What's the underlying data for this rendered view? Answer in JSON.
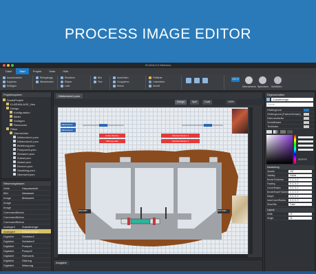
{
  "banner": {
    "title": "PROCESS IMAGE EDITOR"
  },
  "window": {
    "title": "SCADA 5.6 Webview"
  },
  "tabs": [
    {
      "label": "Datei"
    },
    {
      "label": "Start"
    },
    {
      "label": "Projekt"
    },
    {
      "label": "Seite"
    },
    {
      "label": "Hilfe"
    }
  ],
  "ribbon": {
    "g1": [
      "Ausschneiden",
      "Kopieren",
      "Einfügen"
    ],
    "g2": [
      "Rückgängig",
      "Wiederholen"
    ],
    "g3": [
      "Rechteck",
      "Ellipse",
      "Linie"
    ],
    "g4": [
      "Bild",
      "Text"
    ],
    "g5": [
      "Ausrichten",
      "Gruppieren",
      "Ebene"
    ],
    "g6": [
      "Füllfarbe",
      "Linienfarbe",
      "Schrift"
    ],
    "zoom": "100 %",
    "big_buttons": [
      "Übernehmen",
      "Speichern",
      "Schließen"
    ]
  },
  "project_panel": {
    "title": "Projektexplorer",
    "items": [
      {
        "label": "ScadaProjekt",
        "type": "folder",
        "indent": 0
      },
      {
        "label": "KLÄRANLAGE_Neu",
        "type": "folder",
        "indent": 1
      },
      {
        "label": "Design",
        "type": "folder",
        "indent": 1
      },
      {
        "label": "Konfiguration",
        "type": "folder",
        "indent": 2
      },
      {
        "label": "Bilder",
        "type": "folder",
        "indent": 2
      },
      {
        "label": "Vorlagen",
        "type": "folder",
        "indent": 2
      },
      {
        "label": "Resourcen",
        "type": "folder",
        "indent": 2
      },
      {
        "label": "Pläne",
        "type": "folder",
        "indent": 1
      },
      {
        "label": "Übersichten",
        "type": "folder",
        "indent": 2
      },
      {
        "label": "Klärbecken1.psm",
        "type": "file",
        "indent": 3
      },
      {
        "label": "Klärbecken2.psm",
        "type": "file",
        "indent": 3
      },
      {
        "label": "Belebung.psm",
        "type": "file",
        "indent": 3
      },
      {
        "label": "Pumpwerk.psm",
        "type": "file",
        "indent": 3
      },
      {
        "label": "Schlamm.psm",
        "type": "file",
        "indent": 3
      },
      {
        "label": "Zulauf.psm",
        "type": "file",
        "indent": 3
      },
      {
        "label": "Ablauf.psm",
        "type": "file",
        "indent": 3
      },
      {
        "label": "Rechen.psm",
        "type": "file",
        "indent": 3
      },
      {
        "label": "Sandfang.psm",
        "type": "file",
        "indent": 3
      },
      {
        "label": "Übersicht.psm",
        "type": "file",
        "indent": 3
      }
    ]
  },
  "props_panel": {
    "title": "Steuerungsbaum",
    "rows": [
      {
        "k": "Seite",
        "v": "Hauptansicht",
        "sel": false
      },
      {
        "k": "Bild",
        "v": "Abwasser",
        "sel": false
      },
      {
        "k": "Image",
        "v": "Messwert",
        "sel": false
      },
      {
        "k": "Image",
        "v": "",
        "sel": false
      },
      {
        "k": "Image",
        "v": "",
        "sel": false
      },
      {
        "k": "CommandButton",
        "v": "",
        "sel": false
      },
      {
        "k": "CommandButton",
        "v": "",
        "sel": false
      },
      {
        "k": "CommandButton",
        "v": "",
        "sel": false
      },
      {
        "k": "Analoglnt",
        "v": "Zulaufmenge",
        "sel": false
      },
      {
        "k": "Analoglnt",
        "v": "Ablaufmenge",
        "sel": true
      },
      {
        "k": "Digitallnt",
        "v": "Schieber1",
        "sel": false
      },
      {
        "k": "Digitallnt",
        "v": "Schieber2",
        "sel": false
      },
      {
        "k": "Digitallnt",
        "v": "Pumpe1",
        "sel": false
      },
      {
        "k": "Digitallnt",
        "v": "Pumpe2",
        "sel": false
      },
      {
        "k": "Digitallnt",
        "v": "Rührwerk",
        "sel": false
      },
      {
        "k": "Digitallnt",
        "v": "Störung",
        "sel": false
      },
      {
        "k": "Digitallnt",
        "v": "Warnung",
        "sel": false
      }
    ]
  },
  "editor": {
    "doc_tab": "Klärbecken1.psm",
    "view_buttons": [
      "Design",
      "Split",
      "Code"
    ],
    "zoom": "100%",
    "side_buttons": [
      "Klärbecken1",
      "Klärbecken2"
    ],
    "red_buttons": [
      "Fehler Becken",
      "Wartung aktiv",
      "Überlauf Becken 1",
      "Überlauf Becken 2"
    ],
    "labels": [
      "AMS-SN83",
      "AMS-SN84"
    ],
    "bottom_title": "Ausgabe"
  },
  "right_panel": {
    "title": "Eigenschaften",
    "name": "Zulaufmenge",
    "search": "Suche",
    "color_rows": [
      "Hintergrund",
      "Hintergrund (Farbe/Verlauf)",
      "Rahmenfarbe",
      "Schriftfarbe",
      "Textfarbe"
    ],
    "hex": "FFFFFF",
    "section": "Darstellung",
    "props": [
      {
        "k": "Opacity",
        "v": "100"
      },
      {
        "k": "Visibility",
        "v": "Visible"
      },
      {
        "k": "BorderThickness",
        "v": "1, 1, 1, 1"
      },
      {
        "k": "Padding",
        "v": "0, 0, 0, 0"
      },
      {
        "k": "CornerRadius",
        "v": "0, 0, 0, 0"
      },
      {
        "k": "BorderBrushThickness",
        "v": "1, 1, 1, 1"
      },
      {
        "k": "Margin",
        "v": "0, 0, 0, 0"
      },
      {
        "k": "InnerCornerRadius",
        "v": "0, 0, 0, 0"
      },
      {
        "k": "ShowTitle",
        "v": "False"
      }
    ],
    "layout_section": "Layout",
    "layout": [
      {
        "k": "Width",
        "v": "24"
      },
      {
        "k": "Height",
        "v": "24"
      }
    ]
  },
  "colors": {
    "accent": "#1e7ac4",
    "banner": "#2a7ab9",
    "alarm": "#e23a3a",
    "earth": "#8a4b1f",
    "selected": "#d7c06a"
  }
}
